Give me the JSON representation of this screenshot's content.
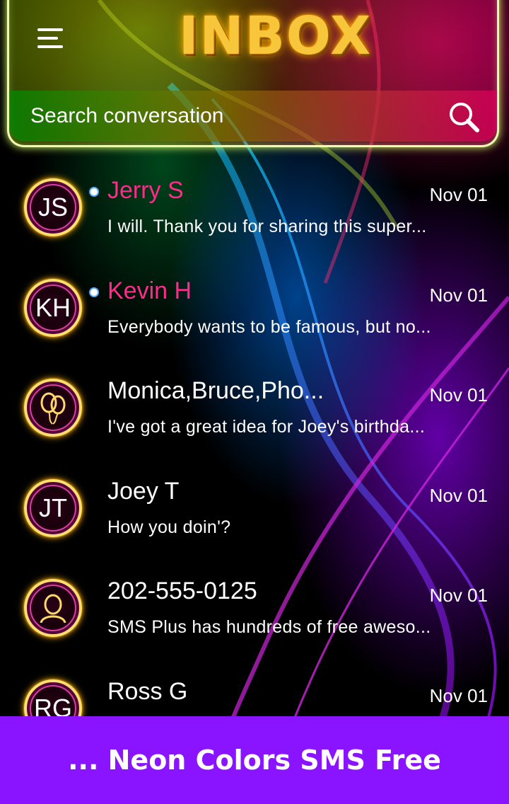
{
  "header": {
    "title": "INBOX",
    "search_placeholder": "Search conversation"
  },
  "conversations": [
    {
      "initials": "JS",
      "name": "Jerry S",
      "date": "Nov 01",
      "snippet": "I will. Thank you for sharing this super...",
      "unread": true
    },
    {
      "initials": "KH",
      "name": "Kevin H",
      "date": "Nov 01",
      "snippet": "Everybody wants to be famous, but no...",
      "unread": true
    },
    {
      "initials": "",
      "icon": "balloons-icon",
      "name": "Monica,Bruce,Pho...",
      "date": "Nov 01",
      "snippet": "I've got a great idea for Joey's birthda...",
      "unread": false
    },
    {
      "initials": "JT",
      "name": "Joey T",
      "date": "Nov 01",
      "snippet": "How you doin'?",
      "unread": false
    },
    {
      "initials": "",
      "icon": "person-icon",
      "name": "202-555-0125",
      "date": "Nov 01",
      "snippet": "SMS Plus has hundreds of free aweso...",
      "unread": false
    },
    {
      "initials": "RG",
      "name": "Ross G",
      "date": "Nov 01",
      "snippet": "",
      "unread": false
    }
  ],
  "promo": {
    "text": "... Neon Colors SMS Free"
  },
  "colors": {
    "unread_name": "#ff2a89",
    "promo_bg": "#8a14ff",
    "title_gold": "#f7c63a"
  }
}
